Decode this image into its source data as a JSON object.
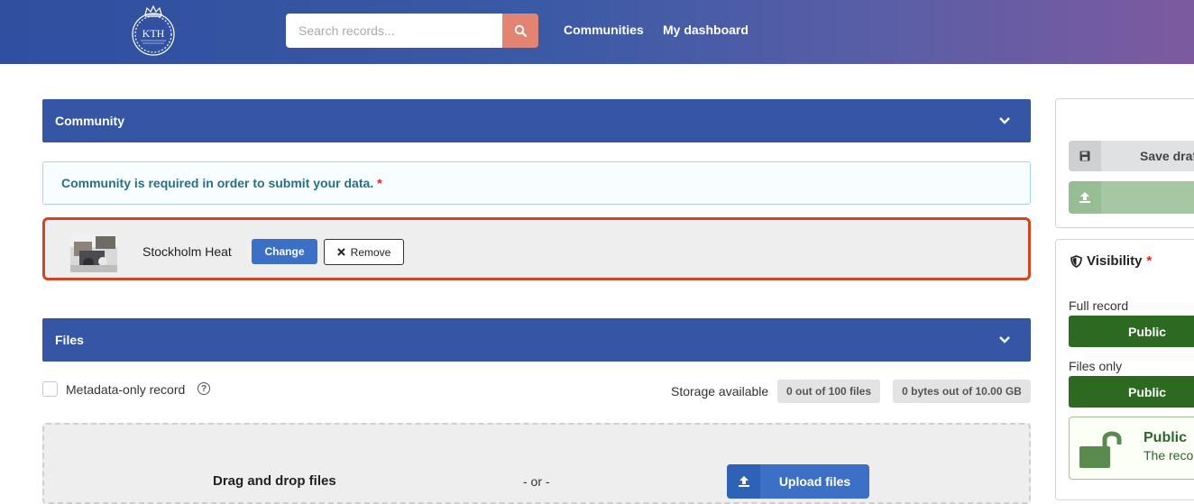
{
  "header": {
    "logo_text": "KTH",
    "search_placeholder": "Search records...",
    "nav": [
      "Communities",
      "My dashboard"
    ]
  },
  "community_panel": {
    "title": "Community",
    "required_message": "Community is required in order to submit your data.",
    "required_mark": "*",
    "selected_name": "Stockholm Heat",
    "change_label": "Change",
    "remove_label": "Remove"
  },
  "files_panel": {
    "title": "Files",
    "metadata_only_label": "Metadata-only record",
    "help_glyph": "?",
    "storage_label": "Storage available",
    "files_count": "0 out of 100 files",
    "bytes_count": "0 bytes out of 10.00 GB",
    "drag_text": "Drag and drop files",
    "or_text": "- or -",
    "upload_label": "Upload files"
  },
  "sidebar": {
    "save_draft_label": "Save draft",
    "visibility_title": "Visibility",
    "required_mark": "*",
    "full_record_label": "Full record",
    "full_record_value": "Public",
    "files_only_label": "Files only",
    "files_only_value": "Public",
    "public_title": "Public",
    "public_desc": "The record"
  },
  "colors": {
    "header_start": "#2f4f9f",
    "header_end": "#7d5aa0",
    "panel_blue": "#3556a4",
    "error_border": "#d2431f",
    "public_green": "#2c6a22"
  }
}
